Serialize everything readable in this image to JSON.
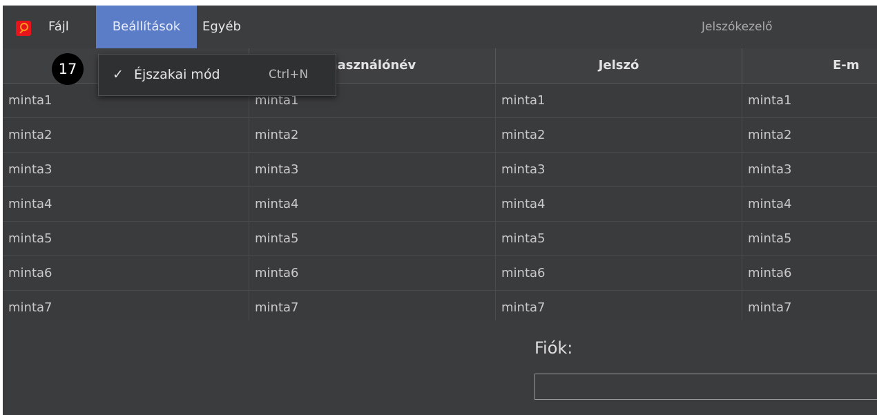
{
  "menubar": {
    "app_icon": "key-icon",
    "items": [
      {
        "label": "Fájl"
      },
      {
        "label": "Beállítások"
      },
      {
        "label": "Egyéb"
      }
    ],
    "title": "Jelszókezelő"
  },
  "dropdown": {
    "checked": true,
    "check_glyph": "✓",
    "item_label": "Éjszakai mód",
    "shortcut": "Ctrl+N"
  },
  "badge": {
    "number": "17"
  },
  "table": {
    "headers": [
      "",
      "használónév",
      "Jelszó",
      "E-m"
    ],
    "rows": [
      [
        "minta1",
        "minta1",
        "minta1",
        "minta1"
      ],
      [
        "minta2",
        "minta2",
        "minta2",
        "minta2"
      ],
      [
        "minta3",
        "minta3",
        "minta3",
        "minta3"
      ],
      [
        "minta4",
        "minta4",
        "minta4",
        "minta4"
      ],
      [
        "minta5",
        "minta5",
        "minta5",
        "minta5"
      ],
      [
        "minta6",
        "minta6",
        "minta6",
        "minta6"
      ],
      [
        "minta7",
        "minta7",
        "minta7",
        "minta7"
      ]
    ]
  },
  "form": {
    "account_label": "Fiók:",
    "account_value": ""
  },
  "colors": {
    "accent": "#5b7cc6",
    "background": "#3a3b3d",
    "icon_red": "#e8141b"
  }
}
